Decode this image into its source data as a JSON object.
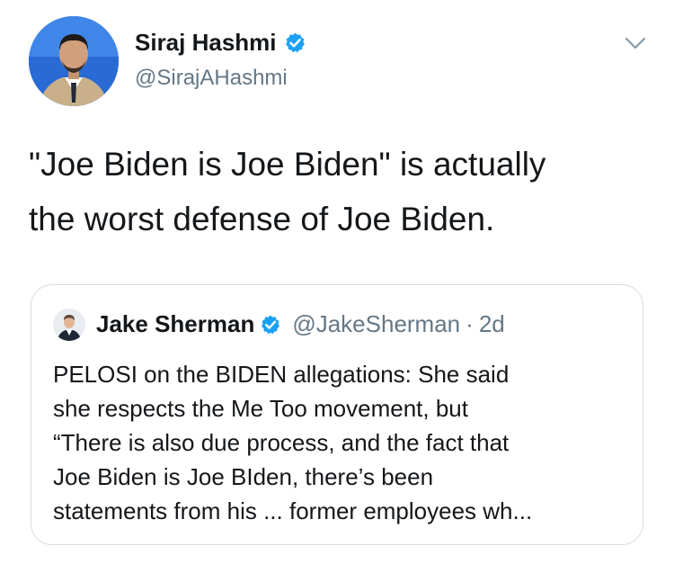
{
  "tweet": {
    "author": {
      "display_name": "Siraj Hashmi",
      "handle": "@SirajAHashmi",
      "verified": true
    },
    "text_lines": [
      "\"Joe Biden is Joe Biden\" is actually",
      "the worst defense of Joe Biden."
    ],
    "menu_icon": "chevron-down-icon"
  },
  "quoted_tweet": {
    "author": {
      "display_name": "Jake Sherman",
      "handle": "@JakeSherman",
      "verified": true
    },
    "separator": "·",
    "timestamp": "2d",
    "text_lines": [
      "PELOSI on the BIDEN allegations: She said",
      "she respects the Me Too movement, but",
      "“There is also due process, and the fact that",
      "Joe Biden is Joe BIden, there’s been",
      "statements from his ... former employees wh..."
    ]
  },
  "colors": {
    "text_primary": "#14171a",
    "text_secondary": "#657786",
    "verified_blue": "#1da1f2",
    "border": "#d8dde2"
  }
}
